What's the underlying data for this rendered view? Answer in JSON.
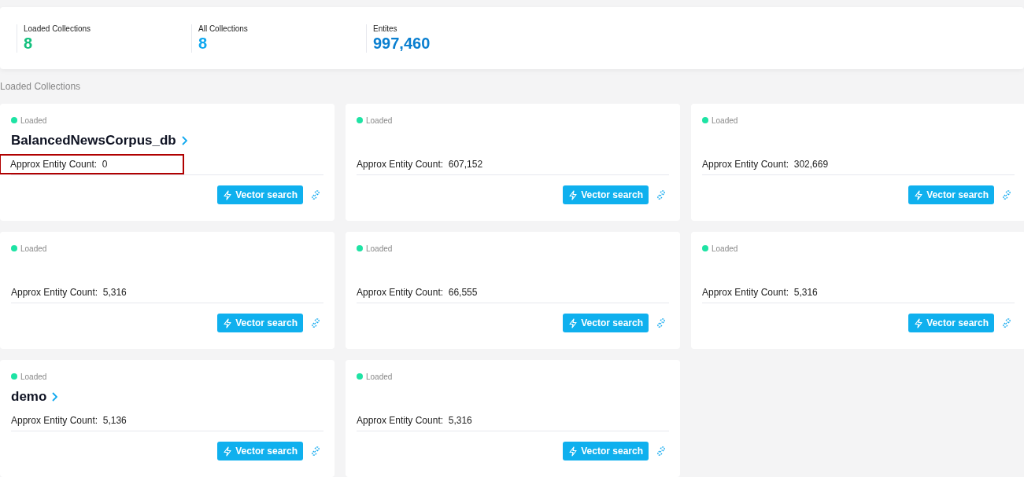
{
  "stats": [
    {
      "label": "Loaded Collections",
      "value": "8",
      "color": "#13c07e"
    },
    {
      "label": "All Collections",
      "value": "8",
      "color": "#0fa8ef"
    },
    {
      "label": "Entites",
      "value": "997,460",
      "color": "#0a7fd0"
    }
  ],
  "section_title": "Loaded Collections",
  "cards": [
    {
      "status": "Loaded",
      "name": "BalancedNewsCorpus_db",
      "count_label": "Approx Entity Count:",
      "count": "0",
      "highlighted": true,
      "button": "Vector search"
    },
    {
      "status": "Loaded",
      "count_label": "Approx Entity Count:",
      "count": "607,152",
      "highlighted": false,
      "button": "Vector search"
    },
    {
      "status": "Loaded",
      "count_label": "Approx Entity Count:",
      "count": "302,669",
      "highlighted": false,
      "button": "Vector search"
    },
    {
      "status": "Loaded",
      "count_label": "Approx Entity Count:",
      "count": "5,316",
      "highlighted": false,
      "button": "Vector search"
    },
    {
      "status": "Loaded",
      "count_label": "Approx Entity Count:",
      "count": "66,555",
      "highlighted": false,
      "button": "Vector search"
    },
    {
      "status": "Loaded",
      "count_label": "Approx Entity Count:",
      "count": "5,316",
      "highlighted": false,
      "button": "Vector search"
    },
    {
      "status": "Loaded",
      "name": "demo",
      "count_label": "Approx Entity Count:",
      "count": "5,136",
      "highlighted": false,
      "button": "Vector search"
    },
    {
      "status": "Loaded",
      "count_label": "Approx Entity Count:",
      "count": "5,316",
      "highlighted": false,
      "button": "Vector search"
    }
  ]
}
